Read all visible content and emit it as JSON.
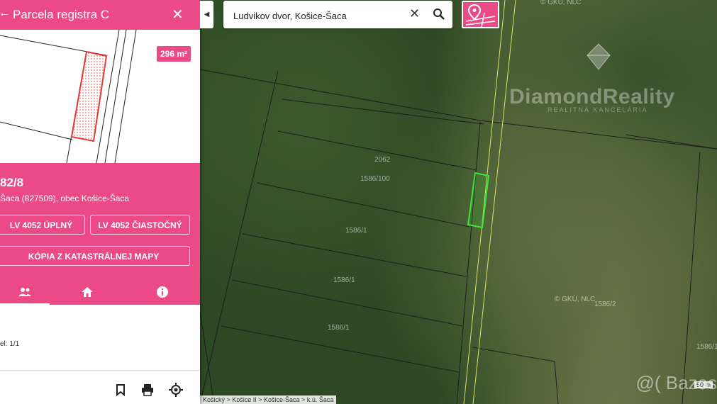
{
  "panel": {
    "title": "Parcela registra C",
    "area": "296 m²",
    "parcel_number": "82/8",
    "parcel_location": "Šaca (827509), obec Košice-Šaca",
    "btn_lv_full": "LV 4052 ÚPLNÝ",
    "btn_lv_partial": "LV 4052 ČIASTOČNÝ",
    "btn_map_copy": "KÓPIA Z KATASTRÁLNEJ MAPY",
    "share": "el: 1/1",
    "tabs": [
      "people-icon",
      "home-icon",
      "info-icon"
    ]
  },
  "search": {
    "value": "Ludvikov dvor, Košice-Šaca"
  },
  "map": {
    "breadcrumb": "Košický > Košice II > Košice-Šaca > k.ú. Šaca",
    "watermark": "DiamondReality",
    "watermark_sub": "REALITNÁ KANCELÁRIA",
    "copyright": "© GKÚ, NLC",
    "parcel_labels": [
      "1586/2",
      "1586/1",
      "2062",
      "1586/100",
      "1586/1",
      "1586/1",
      "1586/1"
    ],
    "scale": "50 m",
    "bazos_mark": "@( Bazos"
  },
  "colors": {
    "accent": "#ec4a87",
    "highlight": "#39e639"
  }
}
